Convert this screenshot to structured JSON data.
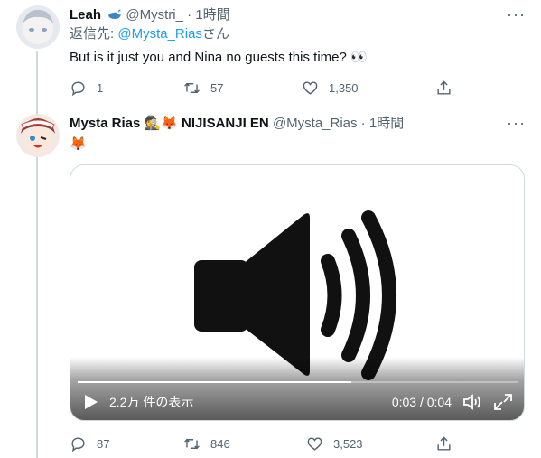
{
  "tweet1": {
    "name": "Leah",
    "handle_time": "@Mystri_ · 1時間",
    "reply_prefix": "返信先: ",
    "reply_mention": "@Mysta_Rias",
    "reply_suffix": "さん",
    "text": "But is it just you and Nina no guests this time? 👀",
    "replies": "1",
    "retweets": "57",
    "likes": "1,350"
  },
  "tweet2": {
    "name": "Mysta Rias 🕵️🦊 NIJISANJI EN",
    "handle_time": "@Mysta_Rias · 1時間",
    "text": "🦊",
    "video": {
      "views": "2.2万 件の表示",
      "time": "0:03 / 0:04",
      "progress": 0.62
    },
    "replies": "87",
    "retweets": "846",
    "likes": "3,523"
  },
  "icons": {
    "reply": "reply-icon",
    "retweet": "retweet-icon",
    "like": "heart-icon",
    "share": "share-icon",
    "more": "more-icon",
    "play": "play-icon",
    "volume": "volume-icon",
    "fullscreen": "fullscreen-icon",
    "speaker": "speaker-icon"
  },
  "colors": {
    "link": "#1d9bf0",
    "muted": "#536471"
  }
}
